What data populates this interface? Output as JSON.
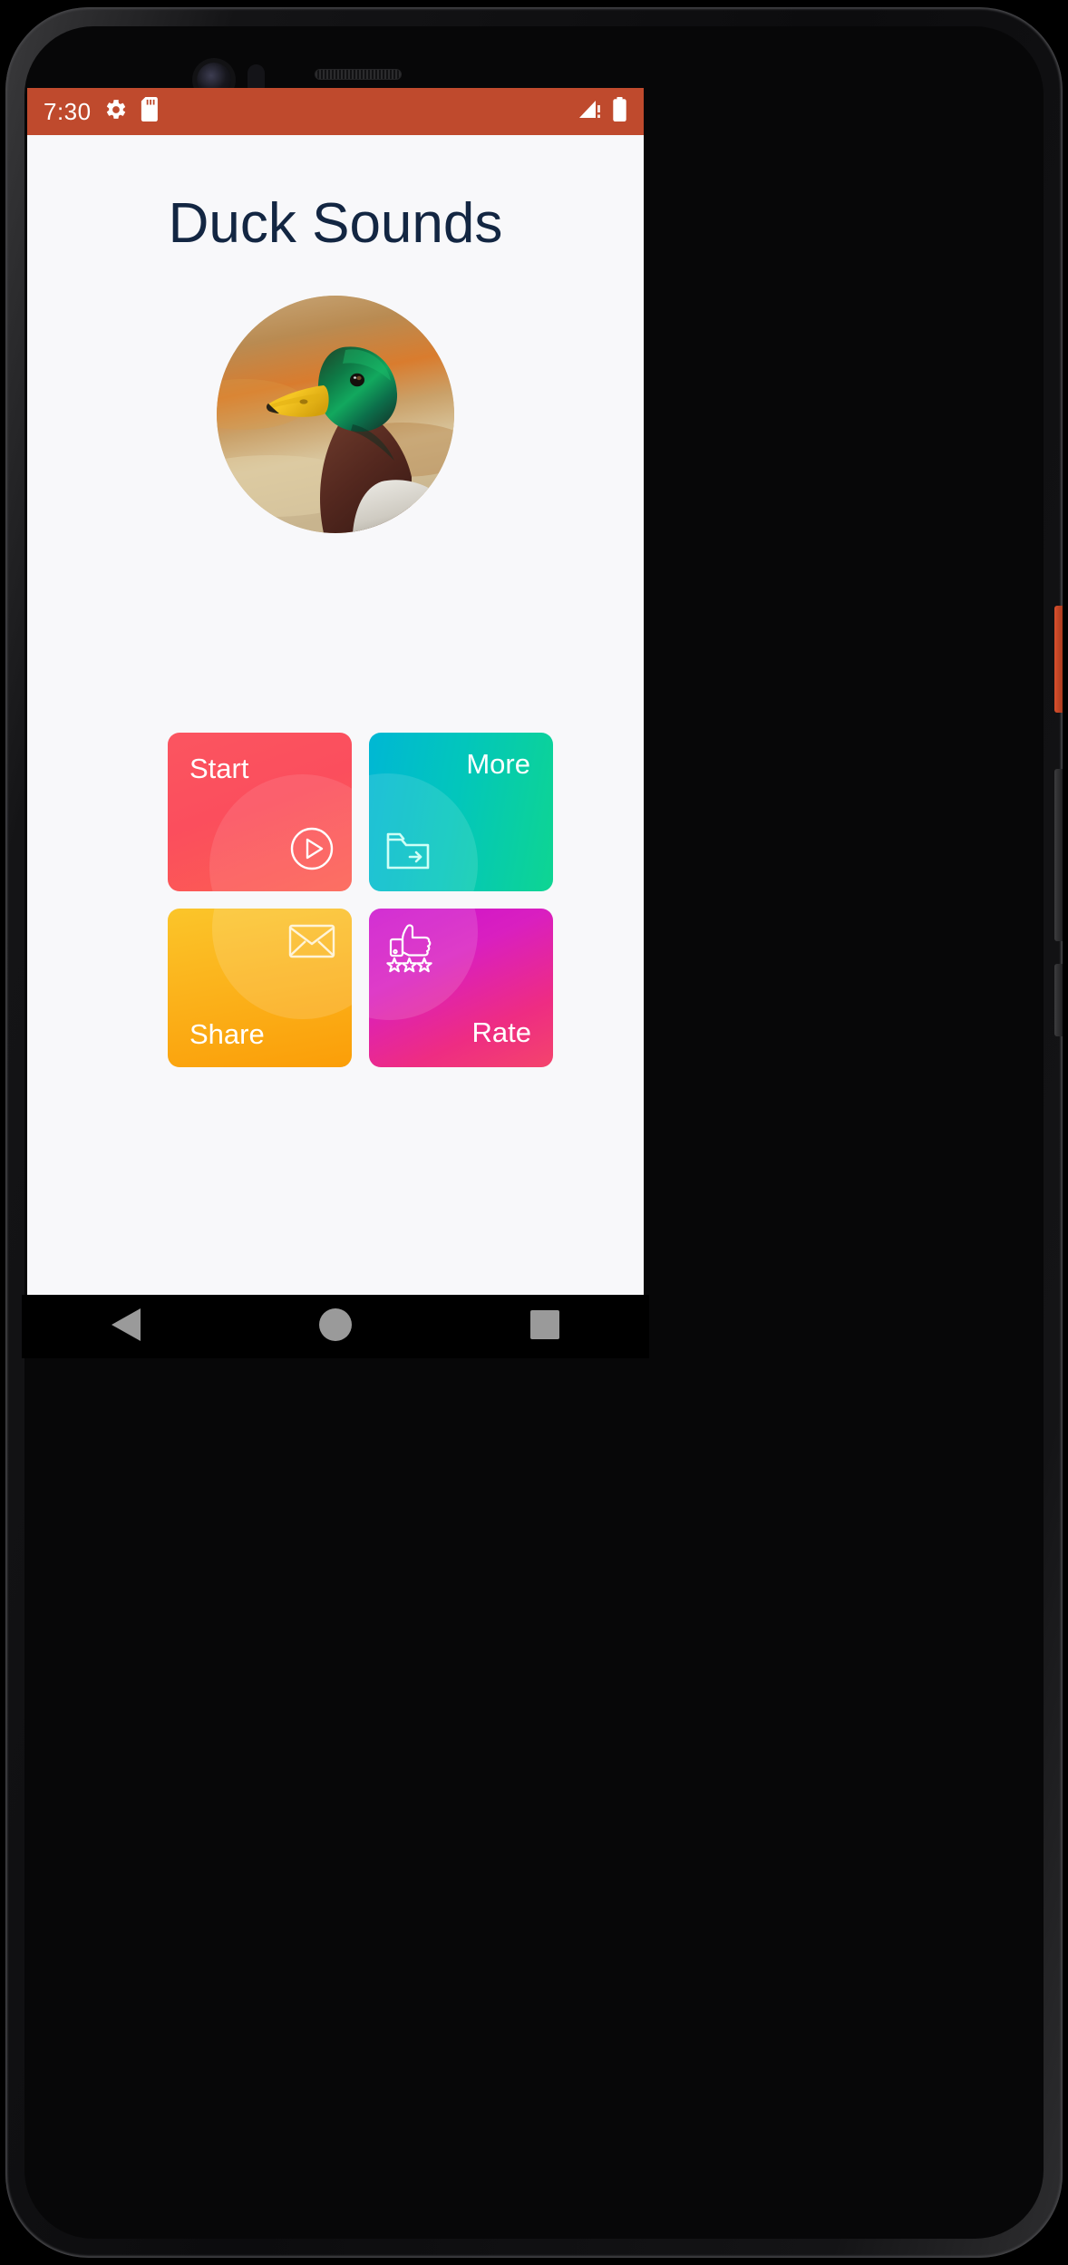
{
  "device": {
    "frame": "android-phone",
    "hardware_icons": [
      "front-camera",
      "proximity-sensor",
      "earpiece-speaker"
    ]
  },
  "status_bar": {
    "time": "7:30",
    "background_color": "#BF4A2D",
    "text_color": "#FFFFFF",
    "left_icons": [
      "gear-icon",
      "sd-card-icon"
    ],
    "right_icons": [
      "signal-bars-icon",
      "battery-icon"
    ]
  },
  "app": {
    "background_color": "#F8F8FA",
    "title": "Duck Sounds",
    "title_color": "#132642",
    "avatar": {
      "name": "duck-photo",
      "alt": "Mallard duck head portrait"
    },
    "tiles": [
      {
        "id": "start",
        "label": "Start",
        "icon": "play-circle-icon",
        "gradient_from": "#FB5560",
        "gradient_to": "#FC6051",
        "label_position": "top-left",
        "icon_position": "bottom-right"
      },
      {
        "id": "more",
        "label": "More",
        "icon": "folder-arrow-icon",
        "gradient_from": "#00B7D4",
        "gradient_to": "#0ED592",
        "label_position": "top-right",
        "icon_position": "bottom-left"
      },
      {
        "id": "share",
        "label": "Share",
        "icon": "envelope-icon",
        "gradient_from": "#FBC52A",
        "gradient_to": "#FB9E08",
        "label_position": "bottom-left",
        "icon_position": "top-right"
      },
      {
        "id": "rate",
        "label": "Rate",
        "icon": "thumbs-up-stars-icon",
        "gradient_from": "#CC11CE",
        "gradient_to": "#F4446C",
        "label_position": "bottom-right",
        "icon_position": "top-left"
      }
    ]
  },
  "nav_bar": {
    "background_color": "#000000",
    "icon_color": "#9A9A9A",
    "buttons": [
      {
        "id": "back",
        "icon": "back-triangle-icon"
      },
      {
        "id": "home",
        "icon": "home-circle-icon"
      },
      {
        "id": "recents",
        "icon": "recents-square-icon"
      }
    ]
  }
}
